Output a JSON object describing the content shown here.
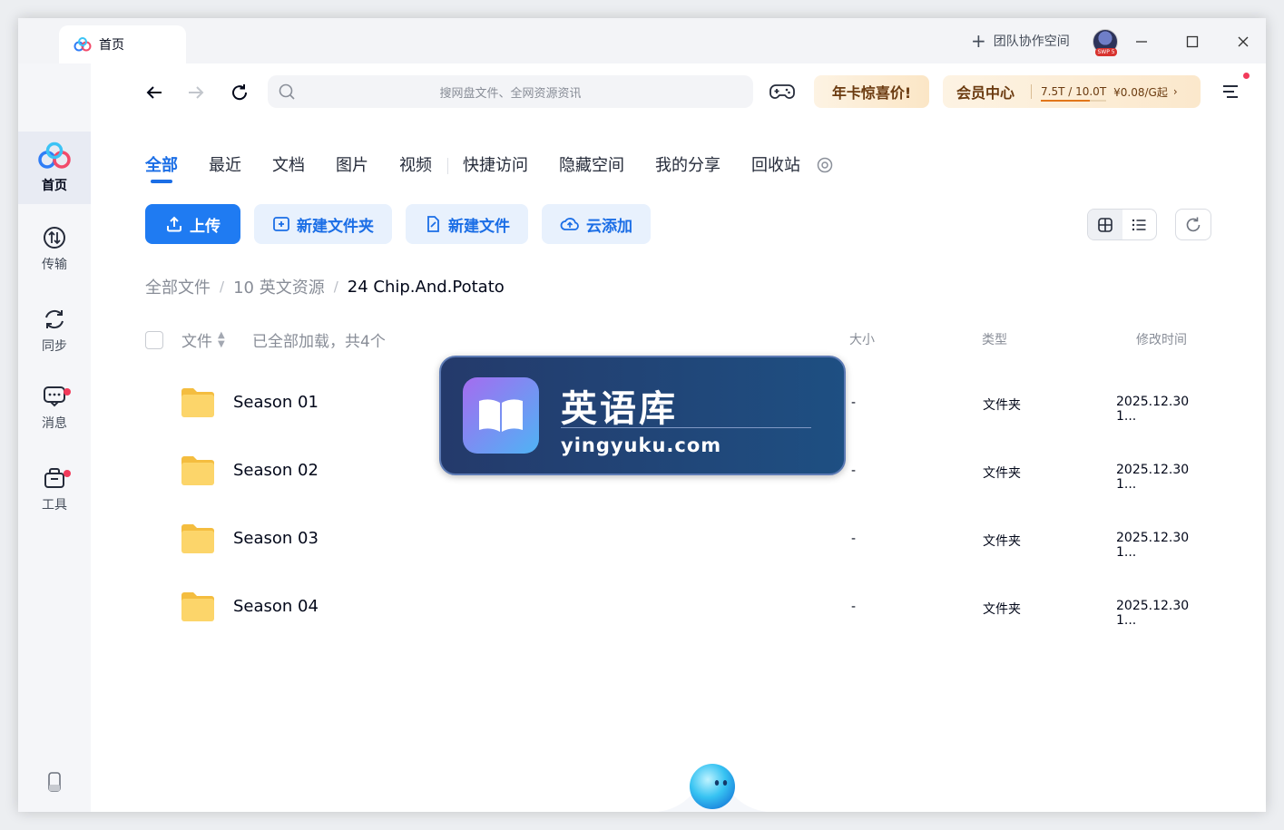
{
  "titlebar": {
    "tab_label": "首页",
    "team_label": "团队协作空间",
    "avatar_badge": "SWP 5"
  },
  "sidebar": {
    "items": [
      {
        "label": "首页"
      },
      {
        "label": "传输"
      },
      {
        "label": "同步"
      },
      {
        "label": "消息"
      },
      {
        "label": "工具"
      }
    ]
  },
  "toolbar": {
    "search_placeholder": "搜网盘文件、全网资源资讯",
    "promo_label": "年卡惊喜价!",
    "vip_label": "会员中心",
    "vip_quota": "7.5T / 10.0T",
    "vip_quota_fraction": 0.75,
    "vip_price": "¥0.08/G起"
  },
  "categories": [
    "全部",
    "最近",
    "文档",
    "图片",
    "视频",
    "快捷访问",
    "隐藏空间",
    "我的分享",
    "回收站"
  ],
  "actions": {
    "upload": "上传",
    "new_folder": "新建文件夹",
    "new_file": "新建文件",
    "cloud_add": "云添加"
  },
  "breadcrumb": [
    "全部文件",
    "10 英文资源",
    "24 Chip.And.Potato"
  ],
  "table": {
    "col_file": "文件",
    "loaded_text": "已全部加载，共4个",
    "col_size": "大小",
    "col_type": "类型",
    "col_time": "修改时间",
    "rows": [
      {
        "name": "Season 01",
        "size": "-",
        "type": "文件夹",
        "time": "2025.12.30 1..."
      },
      {
        "name": "Season 02",
        "size": "-",
        "type": "文件夹",
        "time": "2025.12.30 1..."
      },
      {
        "name": "Season 03",
        "size": "-",
        "type": "文件夹",
        "time": "2025.12.30 1..."
      },
      {
        "name": "Season 04",
        "size": "-",
        "type": "文件夹",
        "time": "2025.12.30 1..."
      }
    ]
  },
  "watermark": {
    "title": "英语库",
    "url": "yingyuku.com"
  },
  "colors": {
    "accent": "#1b6ee6",
    "primary_button": "#1f7bf2",
    "notification_dot": "#f23a5a",
    "folder": "#fcd56a"
  }
}
